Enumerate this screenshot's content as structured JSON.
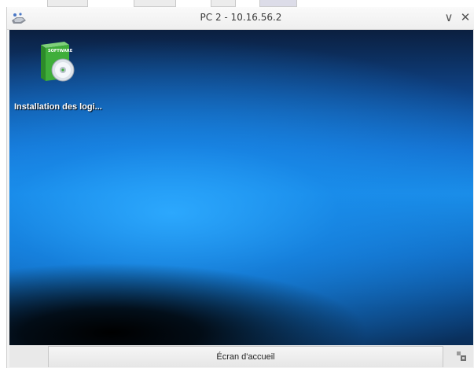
{
  "window": {
    "title": "PC 2 - 10.16.56.2",
    "controls": [
      {
        "name": "minimize",
        "glyph": "∨"
      },
      {
        "name": "close",
        "glyph": "✕"
      }
    ]
  },
  "desktop": {
    "icons": [
      {
        "label": "Installation des logi...",
        "icon": "software-box-cd-icon",
        "box_text": "SOFTWARE"
      }
    ]
  },
  "bottom_bar": {
    "home_button_label": "Écran d'accueil"
  },
  "colors": {
    "desktop_blue": "#1a8ee8",
    "desktop_dark": "#000000",
    "icon_green": "#3fae3a"
  }
}
